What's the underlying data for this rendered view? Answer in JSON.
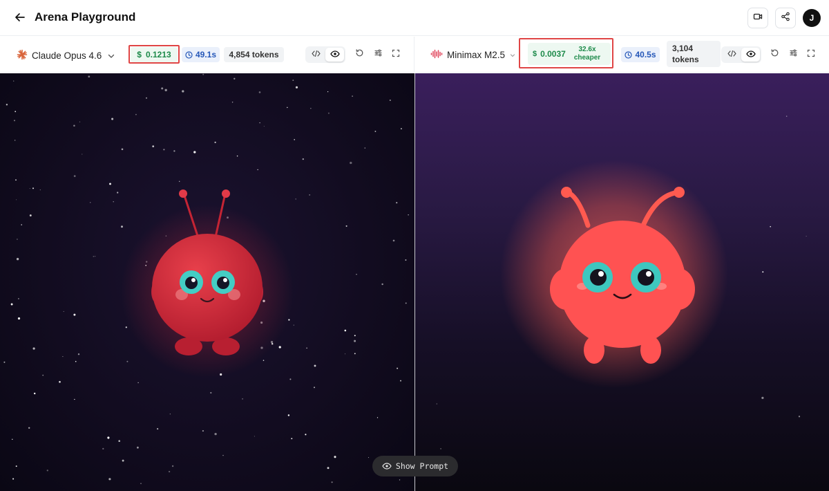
{
  "header": {
    "title": "Arena Playground",
    "avatar_initial": "J"
  },
  "left_panel": {
    "model_name": "Claude Opus 4.6",
    "cost": "0.1213",
    "time": "49.1s",
    "tokens": "4,854 tokens"
  },
  "right_panel": {
    "model_name": "Minimax M2.5",
    "cost": "0.0037",
    "cost_note_1": "32.6x",
    "cost_note_2": "cheaper",
    "time": "40.5s",
    "tokens_1": "3,104",
    "tokens_2": "tokens"
  },
  "show_prompt": "Show Prompt",
  "colors": {
    "cost_green": "#1d8a4a",
    "time_blue": "#2557b8",
    "highlight_red": "#e04545",
    "alien_left": "#d9303f",
    "alien_right": "#ff5252",
    "eye_teal": "#3cc8c0"
  }
}
